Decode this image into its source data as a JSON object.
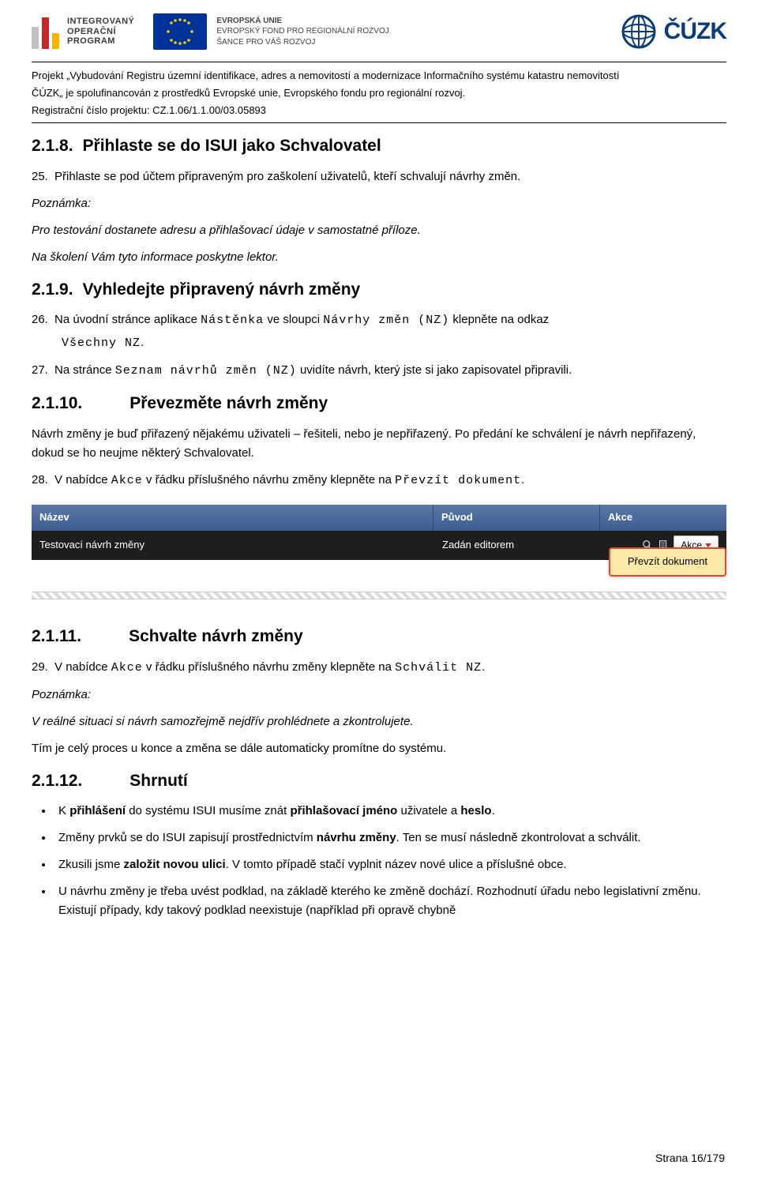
{
  "header": {
    "iop_text": "INTEGROVANÝ\nOPERAČNÍ\nPROGRAM",
    "eu_line1": "EVROPSKÁ UNIE",
    "eu_line2": "EVROPSKÝ FOND PRO REGIONÁLNÍ ROZVOJ",
    "eu_line3": "ŠANCE PRO VÁŠ ROZVOJ",
    "cuzk_text": "ČÚZK"
  },
  "project": {
    "line1": "Projekt „Vybudování Registru územní identifikace, adres a nemovitostí a modernizace Informačního systému katastru nemovitostí",
    "line2": "ČÚZK„ je spolufinancován z prostředků Evropské unie, Evropského fondu pro regionální rozvoj.",
    "line3": "Registrační číslo projektu: CZ.1.06/1.1.00/03.05893"
  },
  "s218": {
    "num": "2.1.8.",
    "title": "Přihlaste se do ISUI jako Schvalovatel",
    "item25_num": "25.",
    "item25_text": "Přihlaste se pod účtem připraveným pro zaškolení uživatelů, kteří schvalují návrhy změn.",
    "note_label": "Poznámka:",
    "note1": "Pro testování dostanete adresu a přihlašovací údaje v samostatné příloze.",
    "note2": "Na školení Vám tyto informace poskytne lektor."
  },
  "s219": {
    "num": "2.1.9.",
    "title": "Vyhledejte připravený návrh změny",
    "item26_num": "26.",
    "item26_a": "Na úvodní stránce aplikace ",
    "item26_mono1": "Nástěnka",
    "item26_b": " ve sloupci ",
    "item26_mono2": "Návrhy změn (NZ)",
    "item26_c": " klepněte na odkaz",
    "item26_mono3": "Všechny NZ",
    "item26_dot": ".",
    "item27_num": "27.",
    "item27_a": "Na stránce ",
    "item27_mono1": "Seznam návrhů změn (NZ)",
    "item27_b": " uvidíte návrh, který jste si jako zapisovatel připravili."
  },
  "s2110": {
    "num": "2.1.10.",
    "title": "Převezměte návrh změny",
    "p1": "Návrh změny je buď přiřazený nějakému uživateli – řešiteli, nebo je nepřiřazený. Po předání ke schválení je návrh nepřiřazený, dokud se ho neujme některý Schvalovatel.",
    "item28_num": "28.",
    "item28_a": "V nabídce ",
    "item28_mono1": "Akce",
    "item28_b": " v řádku příslušného návrhu změny klepněte na ",
    "item28_mono2": "Převzít dokument",
    "item28_dot": "."
  },
  "ui_table": {
    "col_name": "Název",
    "col_origin": "Původ",
    "col_actions": "Akce",
    "row_name": "Testovací návrh změny",
    "row_origin": "Zadán editorem",
    "action_label": "Akce",
    "dropdown_item": "Převzít dokument"
  },
  "s2111": {
    "num": "2.1.11.",
    "title": "Schvalte návrh změny",
    "item29_num": "29.",
    "item29_a": "V nabídce ",
    "item29_mono1": "Akce",
    "item29_b": " v řádku příslušného návrhu změny klepněte na ",
    "item29_mono2": "Schválit NZ",
    "item29_dot": ".",
    "note_label": "Poznámka:",
    "note1": "V reálné situaci si návrh samozřejmě nejdřív prohlédnete a zkontrolujete.",
    "p1": "Tím je celý proces u konce a změna se dále automaticky promítne do systému."
  },
  "s2112": {
    "num": "2.1.12.",
    "title": "Shrnutí",
    "b1_a": "K ",
    "b1_bold1": "přihlášení",
    "b1_b": " do systému ISUI musíme znát ",
    "b1_bold2": "přihlašovací jméno",
    "b1_c": " uživatele a ",
    "b1_bold3": "heslo",
    "b1_dot": ".",
    "b2_a": "Změny prvků se do ISUI zapisují prostřednictvím ",
    "b2_bold1": "návrhu změny",
    "b2_b": ". Ten se musí následně zkontrolovat a schválit.",
    "b3_a": "Zkusili jsme ",
    "b3_bold1": "založit novou ulici",
    "b3_b": ". V tomto případě stačí vyplnit název nové ulice a příslušné obce.",
    "b4": "U návrhu změny je třeba uvést podklad, na základě kterého ke změně dochází. Rozhodnutí úřadu nebo legislativní změnu. Existují případy, kdy takový podklad neexistuje (například při opravě chybně"
  },
  "footer": {
    "page": "Strana 16/179"
  }
}
